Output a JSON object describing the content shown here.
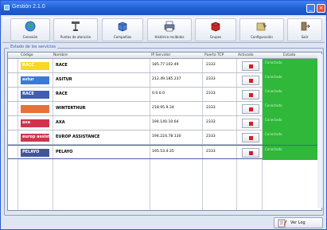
{
  "window": {
    "title": "Gestión 2.1.0"
  },
  "toolbar": {
    "buttons": [
      {
        "label": "Conexión",
        "icon": "globe-icon"
      },
      {
        "label": "Puntos de atención",
        "icon": "tools-icon"
      },
      {
        "label": "Compañías",
        "icon": "box-icon"
      },
      {
        "label": "Histórico recibidos",
        "icon": "printer-icon"
      },
      {
        "label": "Grupos",
        "icon": "cube-icon"
      },
      {
        "label": "Configuración",
        "icon": "config-icon"
      },
      {
        "label": "Salir",
        "icon": "exit-icon"
      }
    ]
  },
  "group": {
    "label": "Estado de los servicios"
  },
  "table": {
    "columns": [
      "Código",
      "Nombre",
      "IP Servidor",
      "Puerto TCP",
      "Activado",
      "Estado"
    ],
    "rows": [
      {
        "logo": "RACC",
        "logo_color": "#f2d200",
        "name": "RACE",
        "ip": "185.77.102.49",
        "port": "2333",
        "status": "Conectado"
      },
      {
        "logo": "astur",
        "logo_color": "#1a5fd6",
        "name": "ASITUR",
        "ip": "212.49.185.237",
        "port": "2333",
        "status": "Conectado"
      },
      {
        "logo": "RACE",
        "logo_color": "#1f3fa8",
        "name": "RACE",
        "ip": "0.0.0.0",
        "port": "2333",
        "status": "Conectado"
      },
      {
        "logo": "",
        "logo_color": "#e05a1a",
        "name": "WINTERTHUR",
        "ip": "218.95.9.34",
        "port": "2333",
        "status": "Conectado"
      },
      {
        "logo": "axa",
        "logo_color": "#c8102e",
        "name": "AXA",
        "ip": "194.140.10.64",
        "port": "2333",
        "status": "Conectado"
      },
      {
        "logo": "europ assistance",
        "logo_color": "#c8102e",
        "name": "EUROP ASSISTANCE",
        "ip": "194.224.78.130",
        "port": "2333",
        "status": "Conectado"
      },
      {
        "logo": "PELAYO",
        "logo_color": "#1b3a8a",
        "name": "PELAYO",
        "ip": "195.53.4.35",
        "port": "2333",
        "status": "Conectado"
      }
    ],
    "selected_row": 6
  },
  "footer": {
    "log_label": "Ver Log"
  },
  "colors": {
    "state_green": "#2fb83a",
    "active_red": "#d0202a",
    "title_blue": "#1f5fd6"
  }
}
